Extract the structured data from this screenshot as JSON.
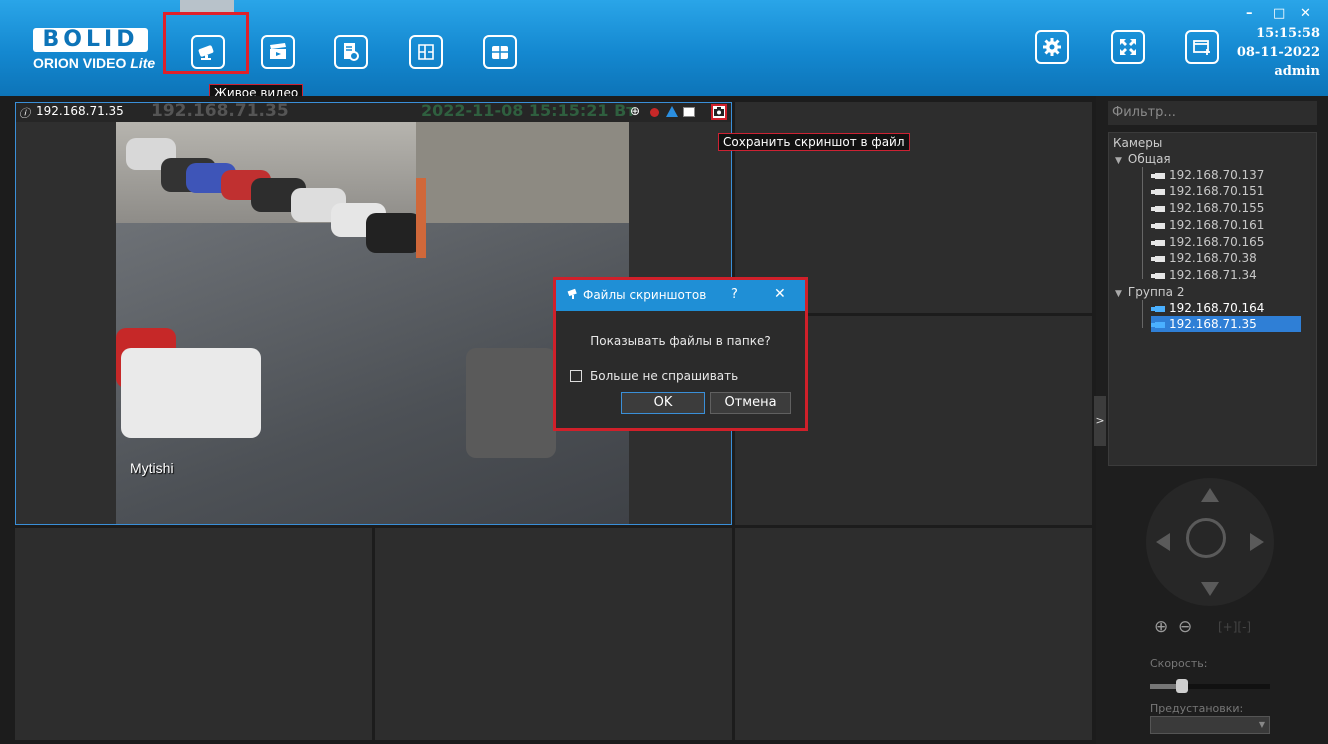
{
  "app": {
    "logo_brand": "BOLID",
    "logo_product": "ORION VIDEO",
    "logo_edition": "Lite"
  },
  "nav": {
    "items": [
      {
        "name": "live-video",
        "tooltip": "Живое видео",
        "active": true
      },
      {
        "name": "archive"
      },
      {
        "name": "events-log"
      },
      {
        "name": "plans"
      },
      {
        "name": "layouts"
      }
    ],
    "right_items": [
      "settings",
      "fullscreen",
      "add-window"
    ]
  },
  "window": {
    "time": "15:15:58",
    "date": "08-11-2022",
    "user": "admin",
    "minimize": "–",
    "maximize": "□",
    "close": "✕"
  },
  "camera_tile": {
    "ip_label": "192.168.71.35",
    "osd_ip": "192.168.71.35",
    "osd_datetime": "2022-11-08 15:15:21 Вт",
    "osd_location": "Mytishi",
    "screenshot_tooltip": "Сохранить скриншот в файл"
  },
  "dialog": {
    "title": "Файлы скриншотов",
    "help": "?",
    "close": "✕",
    "question": "Показывать файлы в папке?",
    "checkbox_label": "Больше не спрашивать",
    "ok": "OK",
    "cancel": "Отмена"
  },
  "panel": {
    "filter_placeholder": "Фильтр...",
    "tree_root": "Камеры",
    "groups": [
      {
        "name": "Общая",
        "cameras": [
          "192.168.70.137",
          "192.168.70.151",
          "192.168.70.155",
          "192.168.70.161",
          "192.168.70.165",
          "192.168.70.38",
          "192.168.71.34"
        ]
      },
      {
        "name": "Группа 2",
        "cameras": [
          "192.168.70.164",
          "192.168.71.35"
        ],
        "selected": "192.168.71.35"
      }
    ],
    "collapse_toggle": ">",
    "speed_label": "Скорость:",
    "presets_label": "Предустановки:"
  },
  "colors": {
    "header_top": "#2aa5e8",
    "header_bottom": "#0d74b8",
    "highlight_red": "#d0202a",
    "selection_blue": "#2f7fd6"
  }
}
